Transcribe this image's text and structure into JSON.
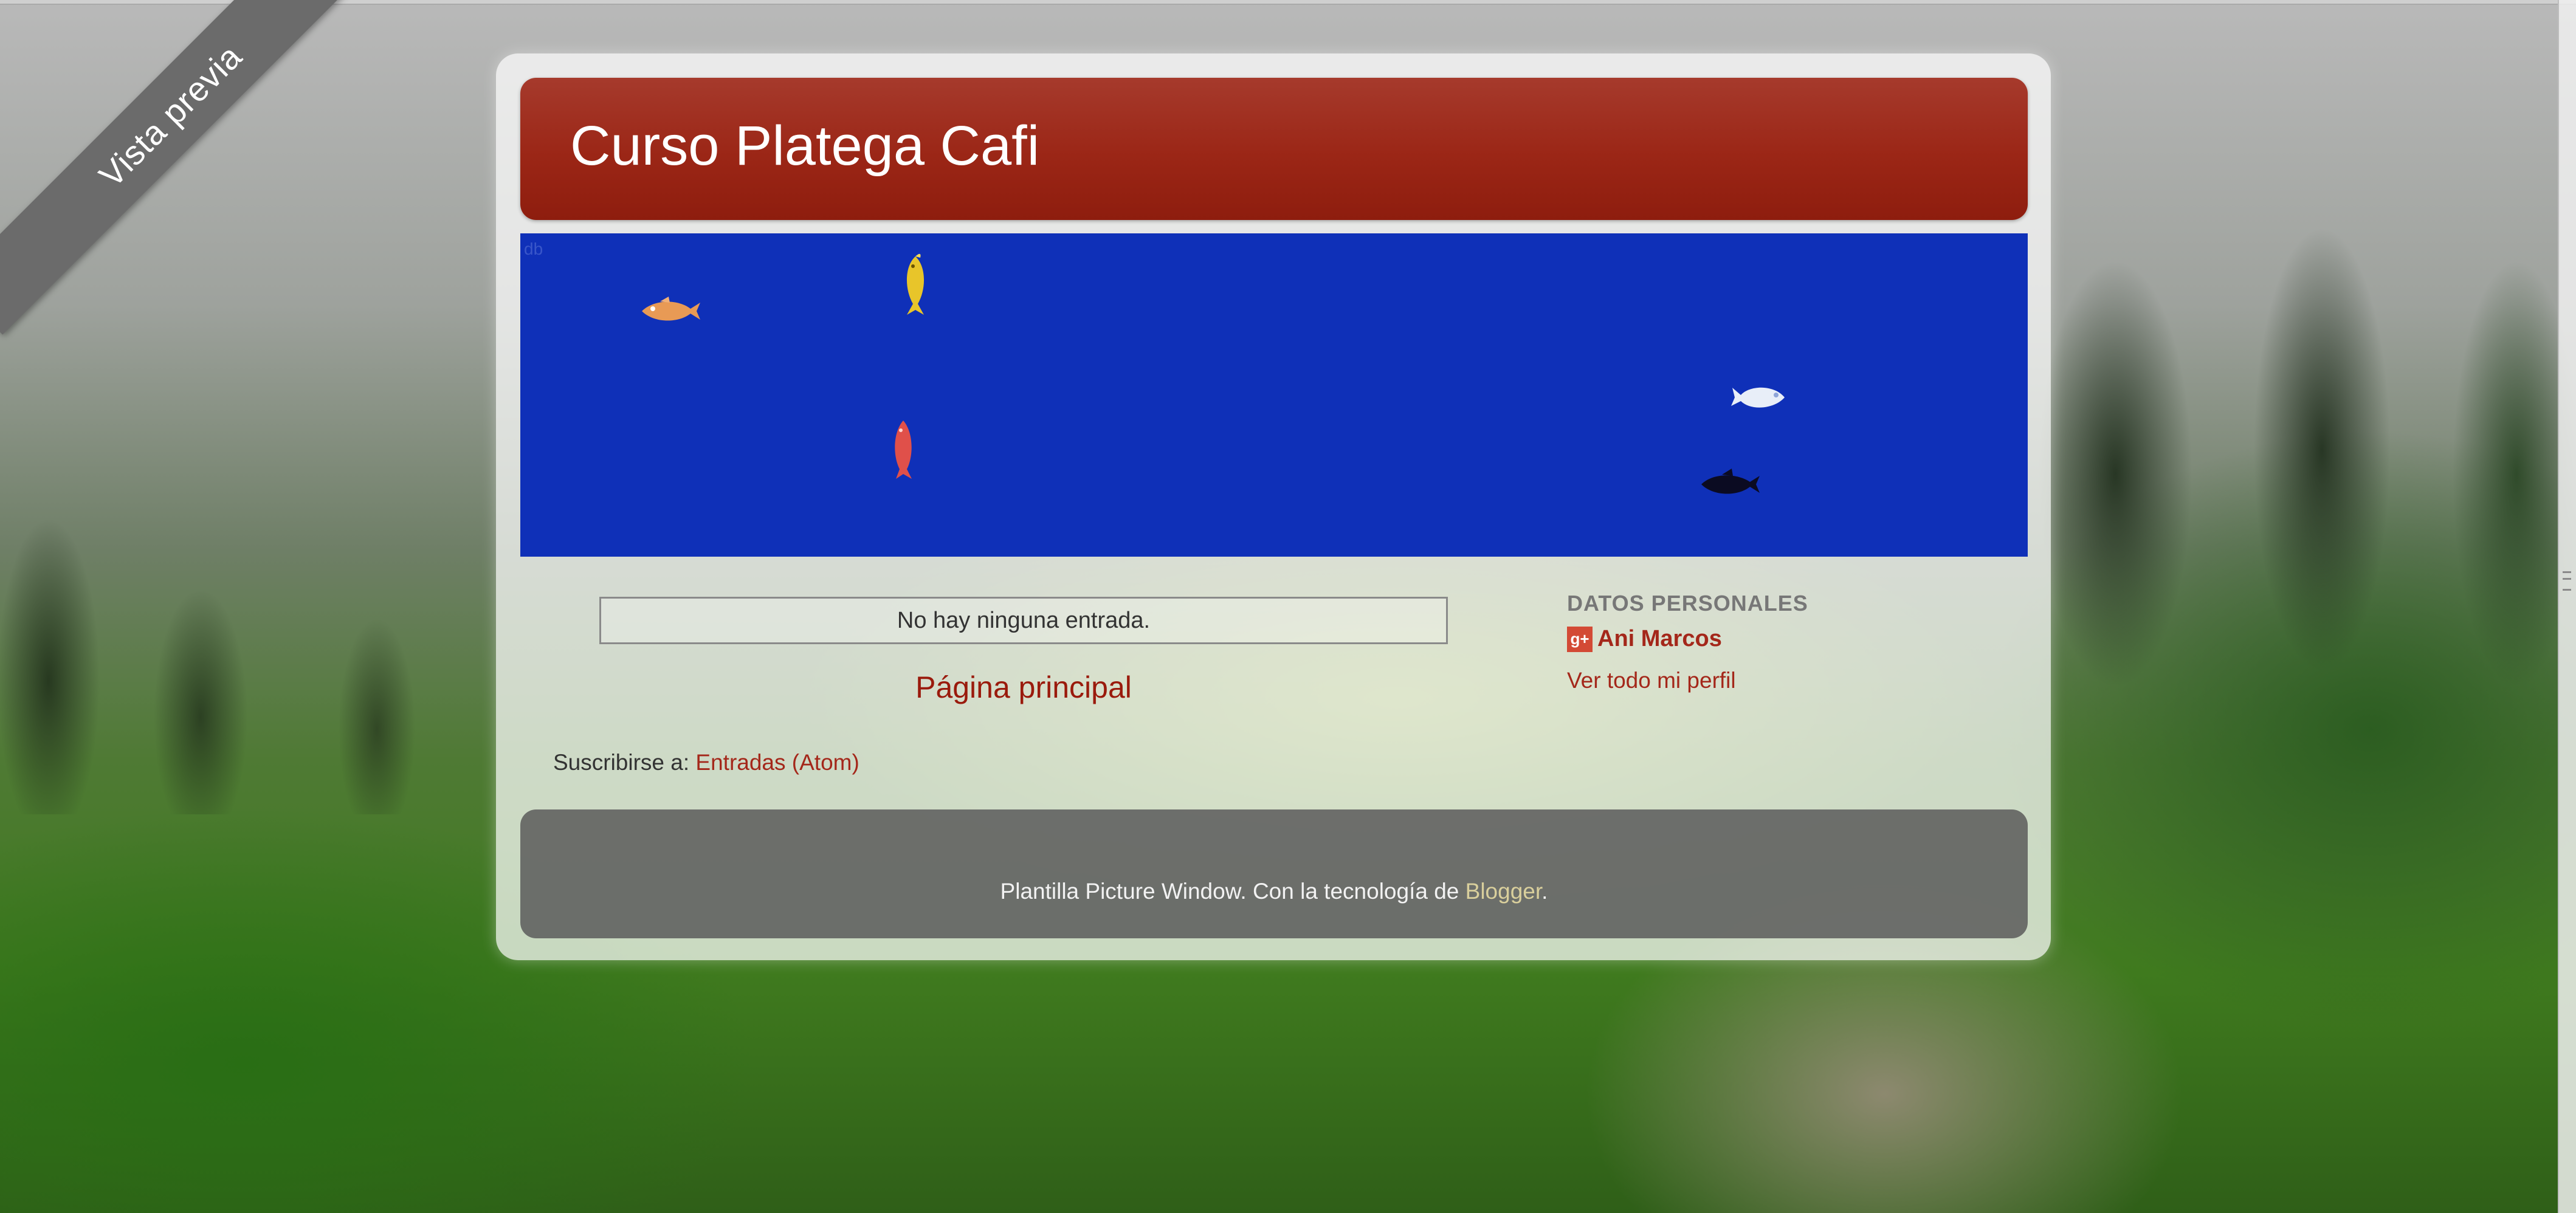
{
  "ribbon": {
    "label": "Vista previa"
  },
  "header": {
    "title": "Curso Platega Cafi"
  },
  "banner": {
    "tag": "db",
    "fish": [
      {
        "name": "orange-fish",
        "color": "#e89a55"
      },
      {
        "name": "yellow-fish",
        "color": "#e8c52a"
      },
      {
        "name": "red-fish",
        "color": "#e0504a"
      },
      {
        "name": "white-fish",
        "color": "#e8eef8"
      },
      {
        "name": "black-fish",
        "color": "#0b0b22"
      }
    ]
  },
  "main": {
    "empty_message": "No hay ninguna entrada.",
    "home_link": "Página principal",
    "subscribe_prefix": "Suscribirse a:",
    "subscribe_link": "Entradas (Atom)"
  },
  "sidebar": {
    "heading": "DATOS PERSONALES",
    "profile_icon": "g+",
    "profile_name": "Ani Marcos",
    "profile_link": "Ver todo mi perfil"
  },
  "footer": {
    "text_prefix": "Plantilla Picture Window. Con la tecnología de",
    "blogger_link": "Blogger",
    "text_suffix": "."
  },
  "colors": {
    "header": "#9b2616",
    "banner": "#0f30b8",
    "link": "#a4271a",
    "footer": "#5a5a5a"
  }
}
